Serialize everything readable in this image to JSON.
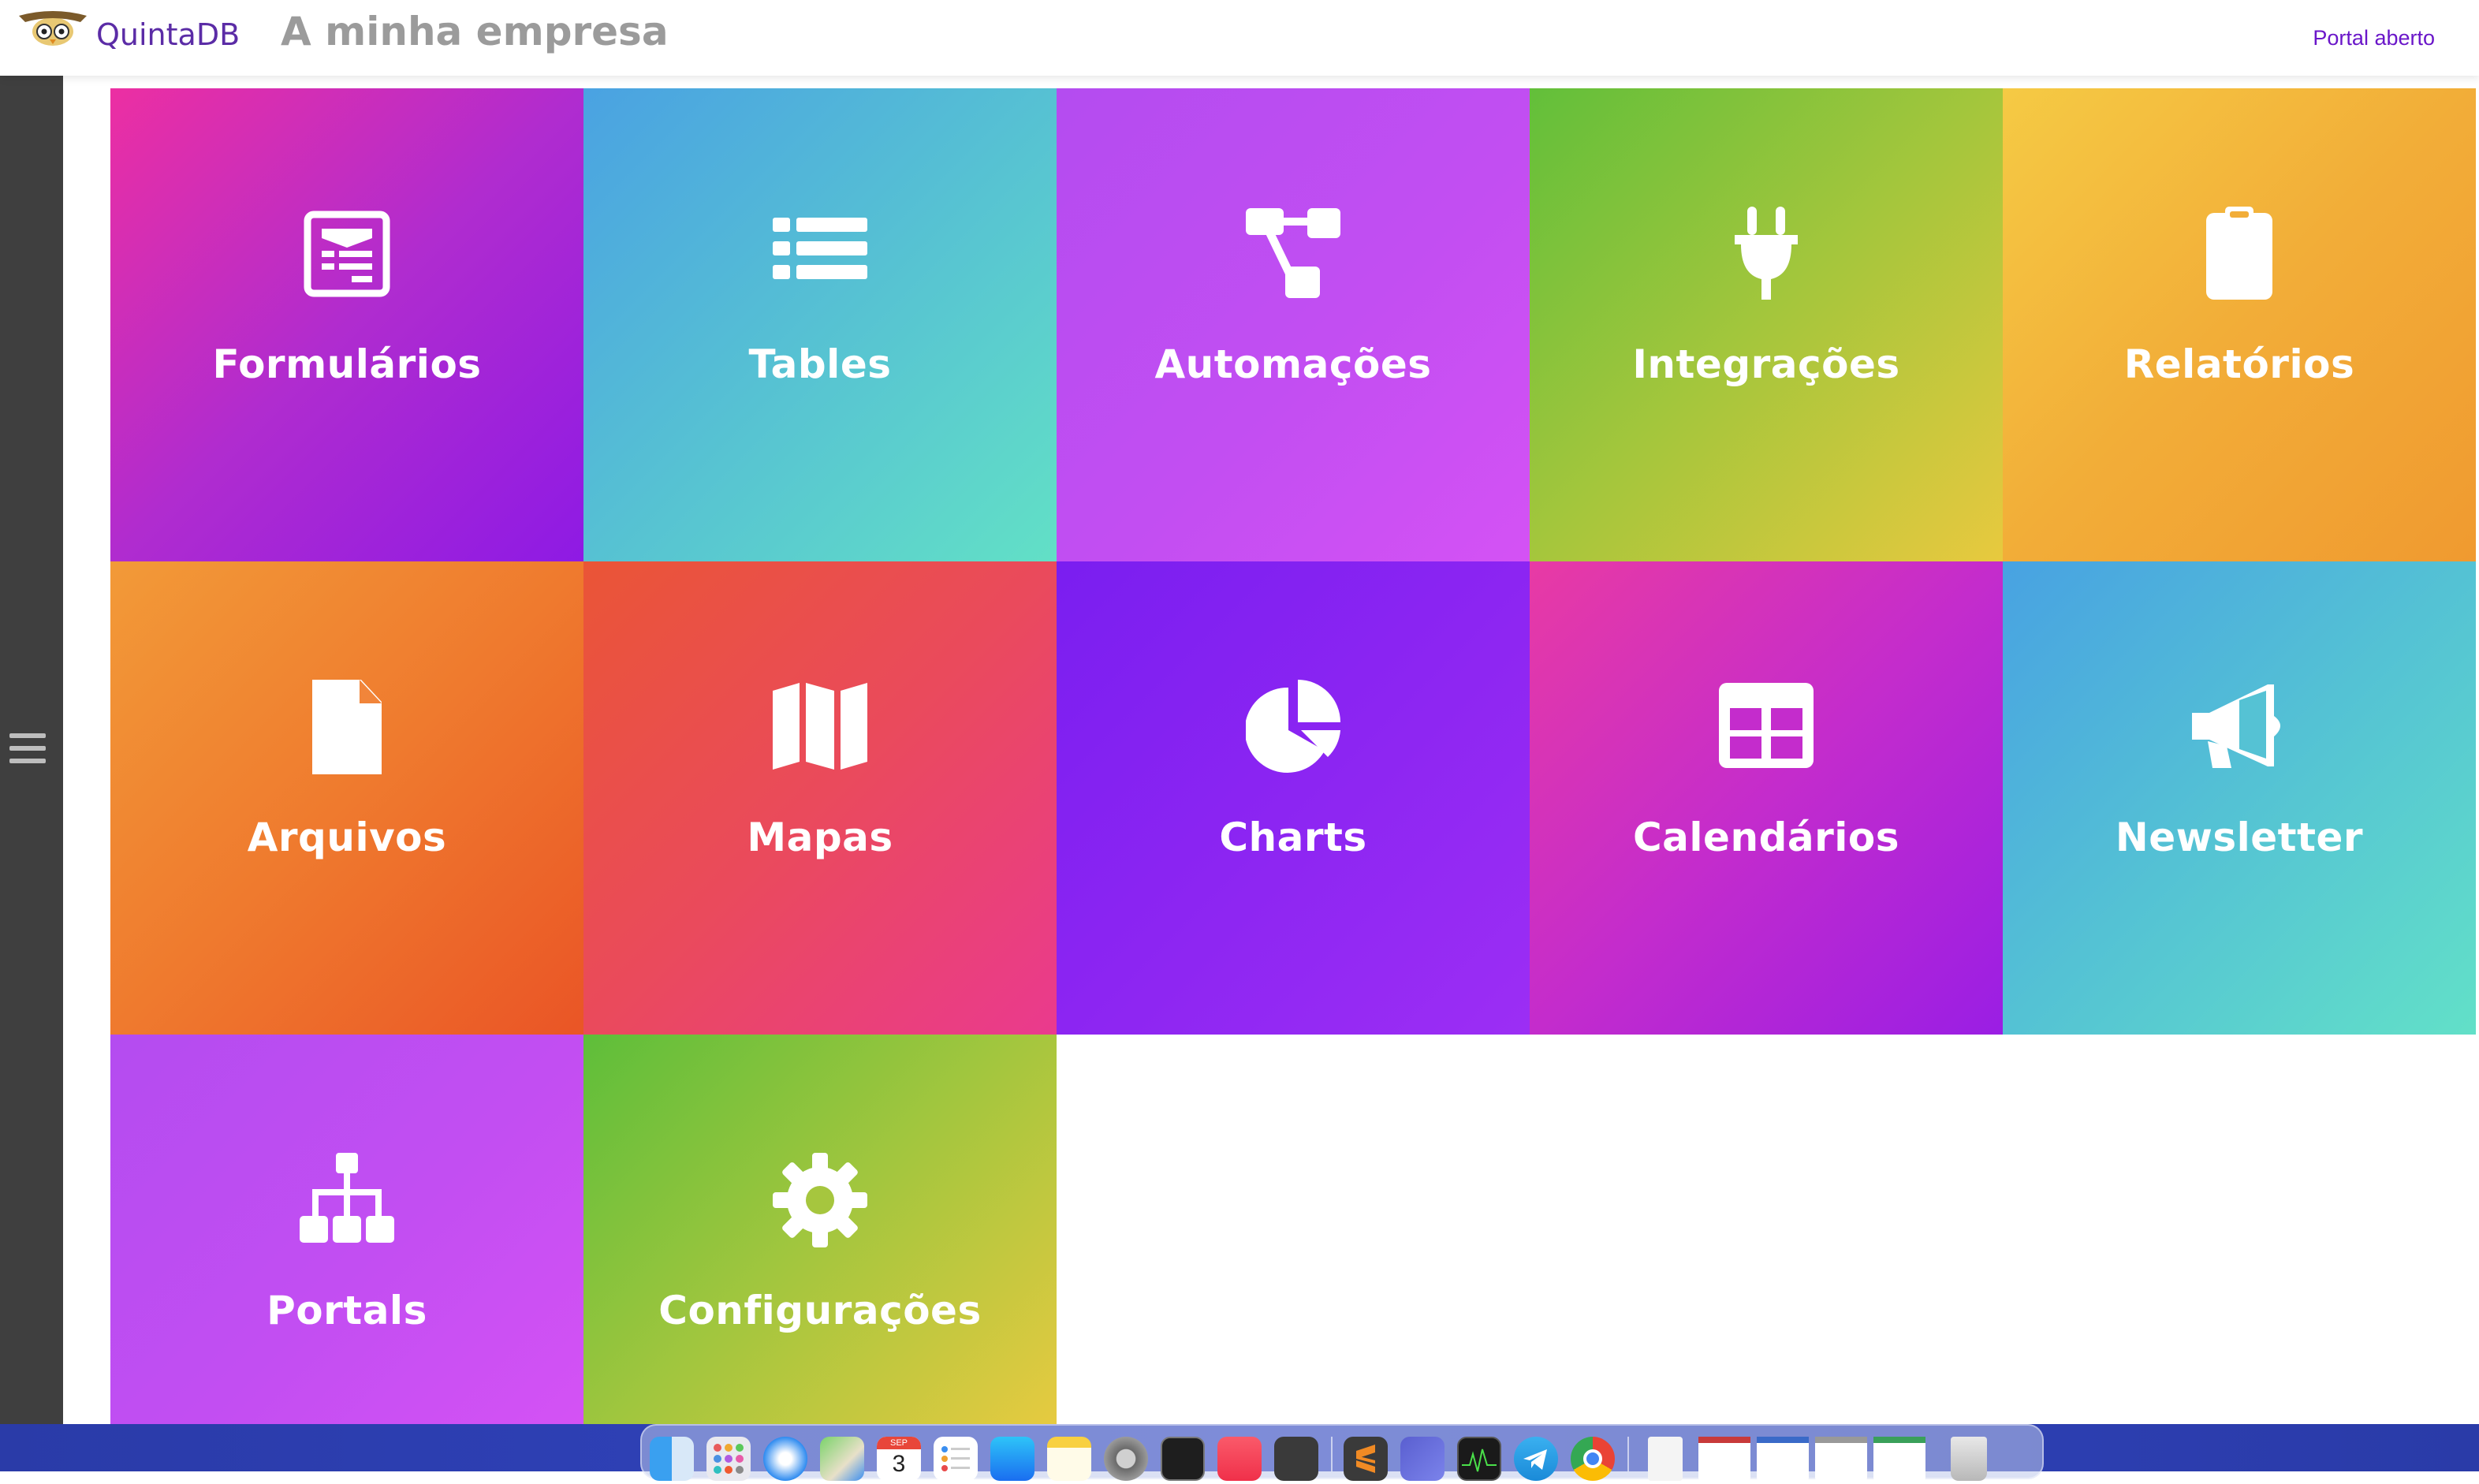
{
  "header": {
    "brand": "QuintaDB",
    "company": "A minha empresa",
    "portal_link": "Portal aberto"
  },
  "tiles": [
    {
      "label": "Formulários",
      "icon": "form-icon"
    },
    {
      "label": "Tables",
      "icon": "list-icon"
    },
    {
      "label": "Automações",
      "icon": "workflow-icon"
    },
    {
      "label": "Integrações",
      "icon": "plug-icon"
    },
    {
      "label": "Relatórios",
      "icon": "clipboard-icon"
    },
    {
      "label": "Arquivos",
      "icon": "file-icon"
    },
    {
      "label": "Mapas",
      "icon": "map-icon"
    },
    {
      "label": "Charts",
      "icon": "pie-chart-icon"
    },
    {
      "label": "Calendários",
      "icon": "calendar-icon"
    },
    {
      "label": "Newsletter",
      "icon": "megaphone-icon"
    },
    {
      "label": "Portals",
      "icon": "sitemap-icon"
    },
    {
      "label": "Configurações",
      "icon": "gear-icon"
    }
  ],
  "dock": {
    "calendar_month": "SEP",
    "calendar_day": "3"
  },
  "colors": {
    "brand": "#5b2ca6",
    "portal_link": "#6a16c9",
    "sidebar": "#3f3f3f"
  }
}
